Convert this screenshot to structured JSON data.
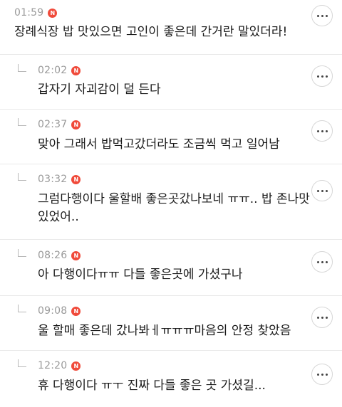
{
  "comments": [
    {
      "time": "01:59",
      "badge": "N",
      "text": "장례식장 밥 맛있으면 고인이 좋은데 간거란 말있더라!",
      "reply": false
    },
    {
      "time": "02:02",
      "badge": "N",
      "text": "갑자기 자괴감이 덜 든다",
      "reply": true
    },
    {
      "time": "02:37",
      "badge": "N",
      "text": "맞아 그래서 밥먹고갔더라도 조금씩 먹고 일어남",
      "reply": true
    },
    {
      "time": "03:32",
      "badge": "N",
      "text_line1": "그럼다행이다 울할배 좋은곳갔나보네 ㅠㅠ.. 밥 존나맛",
      "text_line2": "있었어..",
      "reply": true
    },
    {
      "time": "08:26",
      "badge": "N",
      "text": "아 다행이다ㅠㅠ 다들 좋은곳에 가셨구나",
      "reply": true
    },
    {
      "time": "09:08",
      "badge": "N",
      "text": "울 할매 좋은데 갔나봐ㅔㅠㅠㅠ마음의 안정 찾았음",
      "reply": true
    },
    {
      "time": "12:20",
      "badge": "N",
      "text": "휴 다행이다 ㅠㅜ 진짜 다들 좋은 곳 가셨길...",
      "reply": true
    }
  ]
}
